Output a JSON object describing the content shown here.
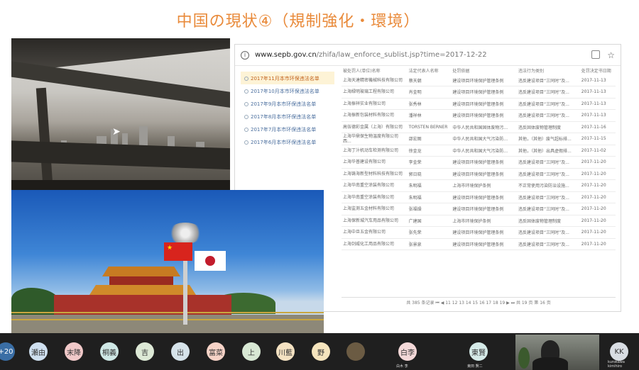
{
  "slide": {
    "title": "中国の現状④（規制強化・環境）"
  },
  "browser": {
    "url_host": "www.sepb.gov.cn",
    "url_path": "/zhifa/law_enforce_sublist.jsp?time=2017-12-22",
    "sidebar": [
      "2017年11月本市环保违法名单",
      "2017年10月本市环保违法名单",
      "2017年9月本市环保违法名单",
      "2017年8月本市环保违法名单",
      "2017年7月本市环保违法名单",
      "2017年6月本市环保违法名单"
    ],
    "table_headers": [
      "被处罚人(单位)名称",
      "法定代表人名称",
      "处罚依据",
      "违法行为类别",
      "处罚决定书日期"
    ],
    "rows": [
      [
        "上海天達精密機械科技有限公司",
        "蔡天朝",
        "建设项目环境保护管理条例",
        "违反建设项目“三同时”及...",
        "2017-11-13"
      ],
      [
        "上海緑明玻璃工程有限公司",
        "肖金明",
        "建设项目环境保护管理条例",
        "违反建设项目“三同时”及...",
        "2017-11-13"
      ],
      [
        "上海振祥实业有限公司",
        "张秀林",
        "建设项目环境保护管理条例",
        "违反建设项目“三同时”及...",
        "2017-11-13"
      ],
      [
        "上海振新包装材料有限公司",
        "潘祥林",
        "建设项目环境保护管理条例",
        "违反建设项目“三同时”及...",
        "2017-11-13"
      ],
      [
        "高伍德彩金属（上海）有限公司",
        "TORSTEN BERNER",
        "中华人民共和国固体废物污...",
        "违反固体废物管理制度",
        "2017-11-16"
      ],
      [
        "上海华鼎保生物温度有限公司西...",
        "邵宏图",
        "中华人民共和国大气污染防...",
        "其他，（其他）废气超标排...",
        "2017-11-15"
      ],
      [
        "上海丁汁机动车检测有限公司",
        "徐金龙",
        "中华人民共和国大气污染防...",
        "其他，（其他）出具虚假排...",
        "2017-11-02"
      ],
      [
        "上海华普建设有限公司",
        "李金荣",
        "建设项目环境保护管理条例",
        "违反建设项目“三同时”及...",
        "2017-11-20"
      ],
      [
        "上海铸海新型材料科技有限公司",
        "郭日晓",
        "建设项目环境保护管理条例",
        "违反建设项目“三同时”及...",
        "2017-11-20"
      ],
      [
        "上海华南重空涂装有限公司",
        "朱明福",
        "上海市环境保护条例",
        "不正常使用污染防治设施...",
        "2017-11-20"
      ],
      [
        "上海华南重空涂装有限公司",
        "朱明福",
        "建设项目环境保护管理条例",
        "违反建设项目“三同时”及...",
        "2017-11-20"
      ],
      [
        "上海监测五金材料有限公司",
        "张福燥",
        "建设项目环境保护管理条例",
        "违反建设项目“三同时”及...",
        "2017-11-20"
      ],
      [
        "上海保新城汽车用品有限公司",
        "广建国",
        "上海市环境保护条例",
        "违反固体废物管理制度",
        "2017-11-20"
      ],
      [
        "上海中旦五金有限公司",
        "张先荣",
        "建设项目环境保护管理条例",
        "违反建设项目“三同时”及...",
        "2017-11-20"
      ],
      [
        "上海剑威化工用品有限公司",
        "张景泉",
        "建设项目环境保护管理条例",
        "违反建设项目“三同时”及...",
        "2017-11-20"
      ]
    ],
    "pager": "共 385 条记录  ⏮ ◀  11  12  13  14  15  16  17  18  19  ▶ ⏭  共 19 页 第 16 页"
  },
  "participants": [
    {
      "label": "+20",
      "color": "#3a6ea5"
    },
    {
      "label": "瀬由",
      "color": "#cfe0f0"
    },
    {
      "label": "末降",
      "color": "#f1c9c9"
    },
    {
      "label": "桐義",
      "color": "#cfe8e6"
    },
    {
      "label": "吉",
      "color": "#dde9d6"
    },
    {
      "label": "出",
      "color": "#d6e3ea"
    },
    {
      "label": "富菜",
      "color": "#f6d3c7"
    },
    {
      "label": "上",
      "color": "#d8e8d4"
    },
    {
      "label": "川藍",
      "color": "#f4e2c2"
    },
    {
      "label": "野",
      "color": "#f5e4bd"
    },
    {
      "label": "",
      "color": "#6b5b43"
    },
    {
      "label": "白李",
      "color": "#f3d8d8",
      "caption": "白木 李"
    },
    {
      "label": "東賢",
      "color": "#d5eae8",
      "caption": "東田 賢二"
    },
    {
      "label": "KK",
      "color": "#d9dde3",
      "caption": "kurokawa kimihiro"
    }
  ],
  "colors": {
    "title": "#e98a3a",
    "link": "#4a6e9e",
    "active_link": "#c2621a"
  }
}
